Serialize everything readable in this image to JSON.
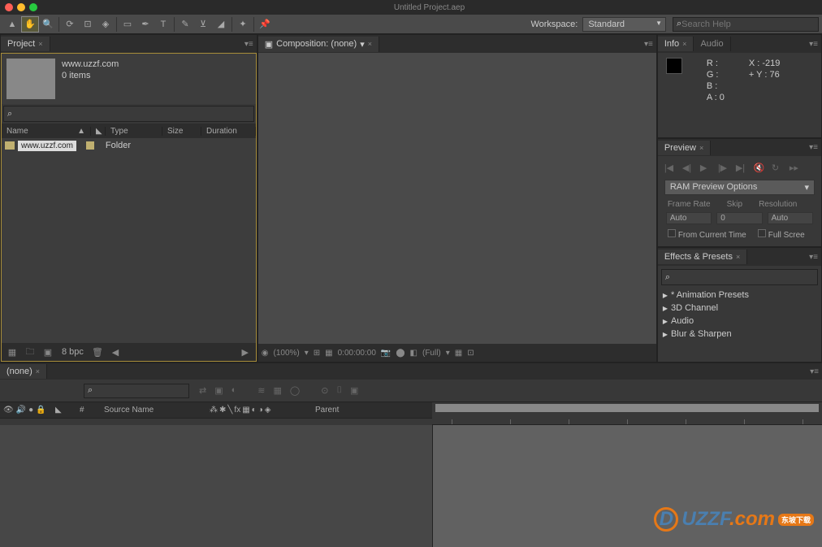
{
  "title": "Untitled Project.aep",
  "workspace": {
    "label": "Workspace:",
    "value": "Standard"
  },
  "search_help_placeholder": "Search Help",
  "project": {
    "tab": "Project",
    "name": "www.uzzf.com",
    "items_text": "0 items",
    "cols": {
      "name": "Name",
      "type": "Type",
      "size": "Size",
      "duration": "Duration"
    },
    "row": {
      "name": "www.uzzf.com",
      "type": "Folder"
    },
    "bpc": "8 bpc"
  },
  "composition": {
    "label": "Composition: (none)",
    "zoom": "(100%)",
    "time": "0:00:00:00",
    "res": "(Full)"
  },
  "info": {
    "tab1": "Info",
    "tab2": "Audio",
    "r": "R :",
    "g": "G :",
    "b": "B :",
    "a": "A : 0",
    "x": "X : -219",
    "y": "Y : 76"
  },
  "preview": {
    "tab": "Preview",
    "ram": "RAM Preview Options",
    "fr": "Frame Rate",
    "skip": "Skip",
    "res": "Resolution",
    "auto1": "Auto",
    "zero": "0",
    "auto2": "Auto",
    "from": "From Current Time",
    "full": "Full Scree"
  },
  "fx": {
    "tab": "Effects & Presets",
    "items": [
      "* Animation Presets",
      "3D Channel",
      "Audio",
      "Blur & Sharpen"
    ]
  },
  "timeline": {
    "tab": "(none)",
    "cols": {
      "num": "#",
      "source": "Source Name",
      "parent": "Parent"
    }
  },
  "watermark": {
    "text": "UZZF",
    "domain": ".com",
    "badge": "东坡下载"
  }
}
